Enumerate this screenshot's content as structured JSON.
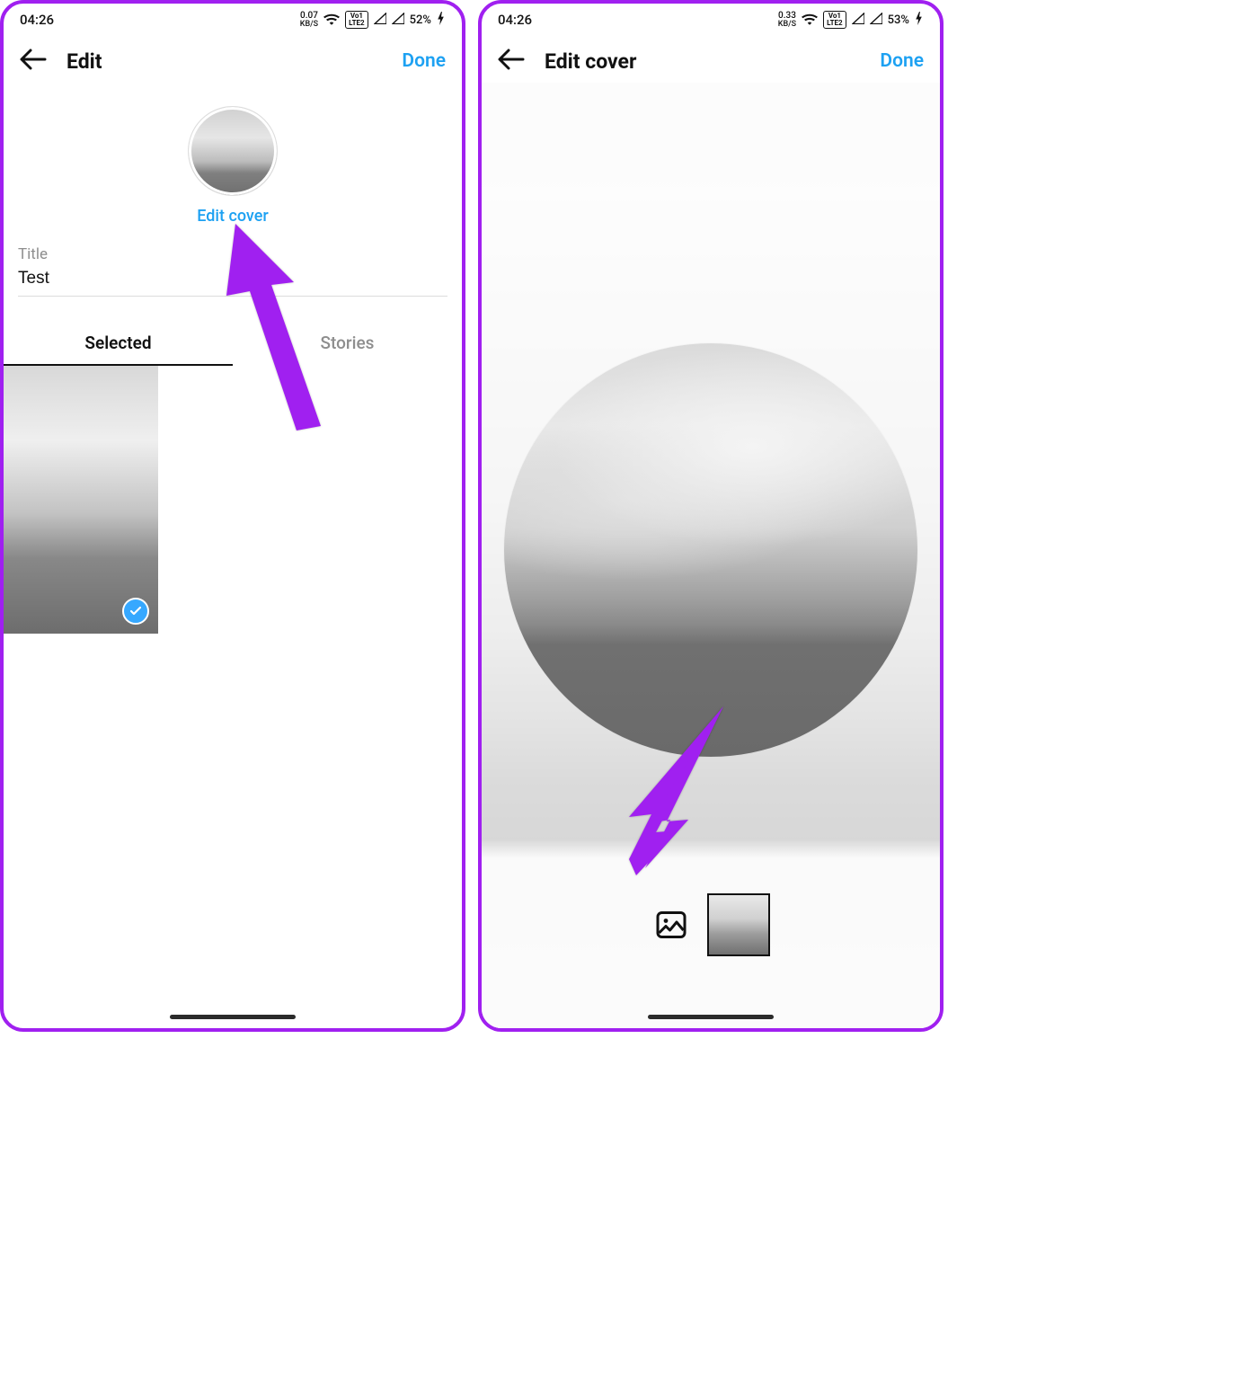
{
  "left": {
    "status": {
      "time": "04:26",
      "speed_top": "0.07",
      "speed_unit": "KB/S",
      "lte_top": "Vo1",
      "lte_bot": "LTE2",
      "battery": "52%"
    },
    "nav": {
      "title": "Edit",
      "done": "Done"
    },
    "cover": {
      "edit_label": "Edit cover"
    },
    "title_field": {
      "label": "Title",
      "value": "Test"
    },
    "tabs": {
      "selected": "Selected",
      "stories": "Stories"
    }
  },
  "right": {
    "status": {
      "time": "04:26",
      "speed_top": "0.33",
      "speed_unit": "KB/S",
      "lte_top": "Vo1",
      "lte_bot": "LTE2",
      "battery": "53%"
    },
    "nav": {
      "title": "Edit cover",
      "done": "Done"
    }
  },
  "colors": {
    "accent": "#1da1f2",
    "annotation": "#a020f0"
  }
}
